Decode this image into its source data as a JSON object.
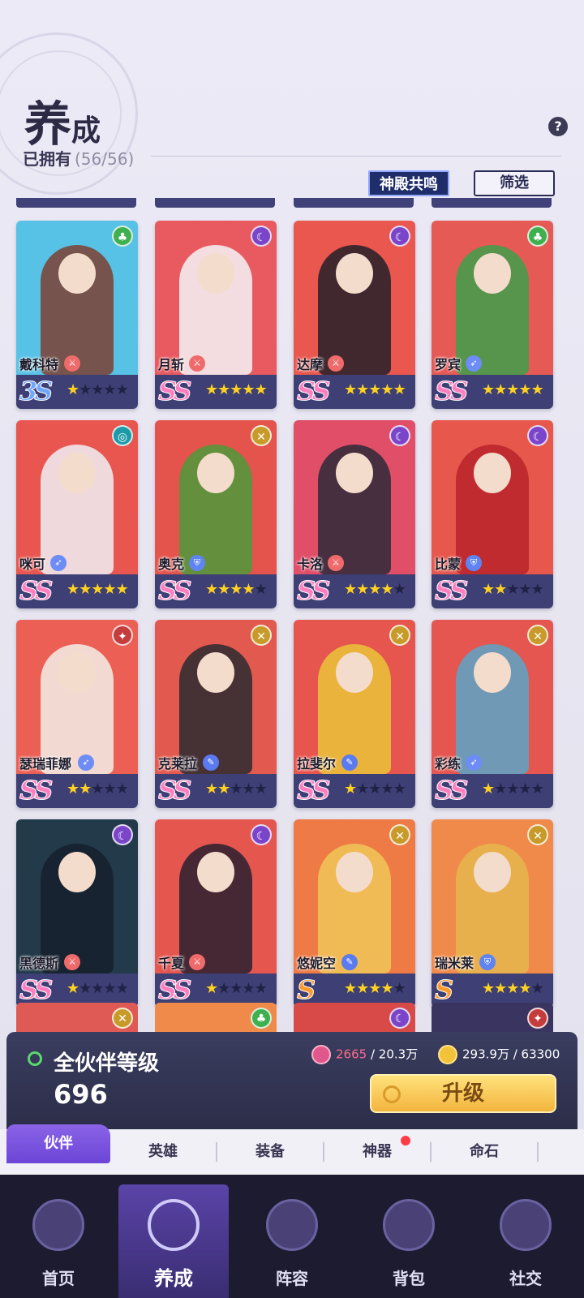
{
  "header": {
    "title_big": "养",
    "title_small": "成",
    "owned_label": "已拥有",
    "owned_count": "(56/56)",
    "help_icon": "question-icon",
    "temple_button": "神殿共鸣",
    "filter_button": "筛选"
  },
  "colors": {
    "card_bar": "#3d3f75",
    "star_on": "#ffd21f",
    "star_off": "#1f2145",
    "accent_purple": "#7a54e0",
    "upgrade_gold": "#f3b43e"
  },
  "heroes": [
    {
      "name": "戴科特",
      "rank": "3S",
      "stars": 1,
      "element": "nature-icon",
      "role": "sword-icon",
      "bg": "#58c2e6",
      "fig": "#7b4030"
    },
    {
      "name": "月斩",
      "rank": "SS",
      "stars": 5,
      "element": "moon-icon",
      "role": "sword-icon",
      "bg": "#e85a60",
      "fig": "#f5f5f7"
    },
    {
      "name": "达摩",
      "rank": "SS",
      "stars": 5,
      "element": "moon-icon",
      "role": "sword-icon",
      "bg": "#e9574e",
      "fig": "#23202a"
    },
    {
      "name": "罗宾",
      "rank": "SS",
      "stars": 5,
      "element": "nature-icon",
      "role": "bow-icon",
      "bg": "#e65a55",
      "fig": "#3ca04a"
    },
    {
      "name": "咪可",
      "rank": "SS",
      "stars": 5,
      "element": "water-icon",
      "role": "bow-icon",
      "bg": "#e8564f",
      "fig": "#f0f0f4"
    },
    {
      "name": "奥克",
      "rank": "SS",
      "stars": 4,
      "element": "light-icon",
      "role": "shield-icon",
      "bg": "#e4534c",
      "fig": "#4e9a3a"
    },
    {
      "name": "卡洛",
      "rank": "SS",
      "stars": 4,
      "element": "moon-icon",
      "role": "sword-icon",
      "bg": "#e04e68",
      "fig": "#2c2a3a"
    },
    {
      "name": "比蒙",
      "rank": "SS",
      "stars": 2,
      "element": "moon-icon",
      "role": "shield-icon",
      "bg": "#e7574c",
      "fig": "#b8232b"
    },
    {
      "name": "瑟瑞菲娜",
      "rank": "SS",
      "stars": 2,
      "element": "fire-icon",
      "role": "bow-icon",
      "bg": "#ec5f55",
      "fig": "#f3efe9"
    },
    {
      "name": "克莱拉",
      "rank": "SS",
      "stars": 2,
      "element": "light-icon",
      "role": "wand-icon",
      "bg": "#e25a4f",
      "fig": "#2a2a30"
    },
    {
      "name": "拉斐尔",
      "rank": "SS",
      "stars": 1,
      "element": "light-icon",
      "role": "wand-icon",
      "bg": "#e6554e",
      "fig": "#e9c43a"
    },
    {
      "name": "彩练",
      "rank": "SS",
      "stars": 1,
      "element": "light-icon",
      "role": "bow-icon",
      "bg": "#e4564f",
      "fig": "#5ba4c7"
    },
    {
      "name": "黑德斯",
      "rank": "SS",
      "stars": 1,
      "element": "moon-icon",
      "role": "sword-icon",
      "bg": "#223a4a",
      "fig": "#15202c"
    },
    {
      "name": "千夏",
      "rank": "SS",
      "stars": 1,
      "element": "moon-icon",
      "role": "sword-icon",
      "bg": "#e5564f",
      "fig": "#2a2030"
    },
    {
      "name": "悠妮空",
      "rank": "S",
      "stars": 4,
      "element": "light-icon",
      "role": "wand-icon",
      "bg": "#ee7a45",
      "fig": "#f0c658"
    },
    {
      "name": "瑞米莱",
      "rank": "S",
      "stars": 4,
      "element": "light-icon",
      "role": "shield-icon",
      "bg": "#f08a4a",
      "fig": "#e6b64c"
    }
  ],
  "partial_row": [
    {
      "element": "light-icon",
      "bg": "#e05a55"
    },
    {
      "element": "nature-icon",
      "bg": "#f08a4a"
    },
    {
      "element": "moon-icon",
      "bg": "#d84a48"
    },
    {
      "element": "fire-icon",
      "bg": "#3a3560"
    }
  ],
  "panel": {
    "level_label": "全伙伴等级",
    "level_value": "696",
    "res1_current": "2665",
    "res1_total": "/ 20.3万",
    "res2_text": "293.9万 / 63300",
    "upgrade_button": "升级"
  },
  "subtabs": [
    "伙伴",
    "英雄",
    "装备",
    "神器",
    "命石"
  ],
  "nav": [
    "首页",
    "养成",
    "阵容",
    "背包",
    "社交"
  ]
}
